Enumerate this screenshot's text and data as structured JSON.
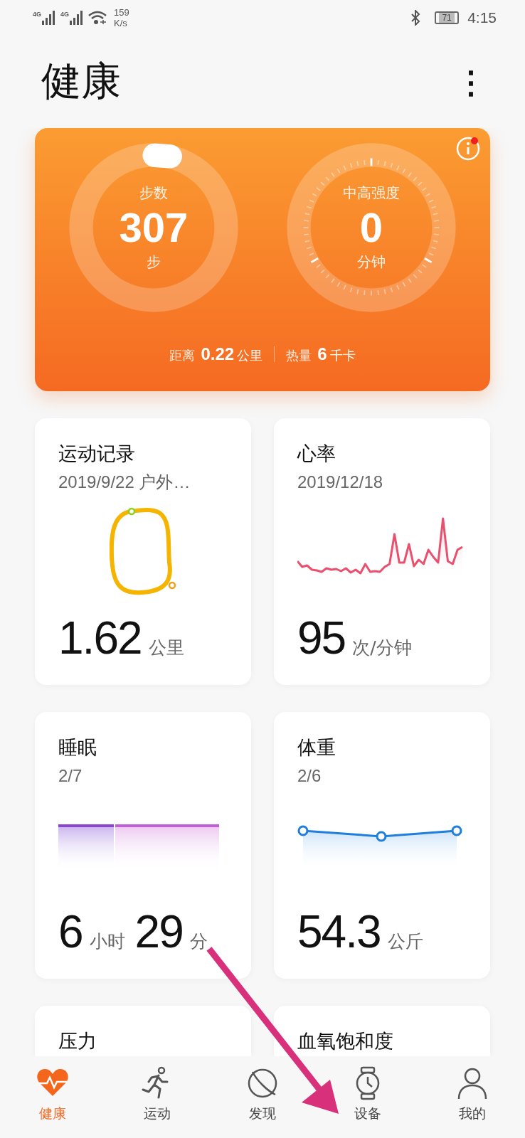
{
  "status_bar": {
    "networks": [
      {
        "label": "4G"
      },
      {
        "label": "4G"
      }
    ],
    "speed": [
      "159",
      "K/s"
    ],
    "battery": "71",
    "time": "4:15"
  },
  "header": {
    "title": "健康",
    "menu": "⋮"
  },
  "summary": {
    "info_badge": true,
    "rings": [
      {
        "kind": "progress",
        "label": "步数",
        "value": "307",
        "unit": "步"
      },
      {
        "kind": "dial",
        "label": "中高强度",
        "value": "0",
        "unit": "分钟"
      }
    ],
    "stats": [
      {
        "label": "距离",
        "value": "0.22",
        "unit": "公里"
      },
      {
        "label": "热量",
        "value": "6",
        "unit": "千卡"
      }
    ]
  },
  "cards": [
    {
      "kind": "route",
      "title": "运动记录",
      "subtitle": "2019/9/22 户外…",
      "values": [
        {
          "number": "1.62",
          "unit": "公里"
        }
      ]
    },
    {
      "kind": "heart",
      "title": "心率",
      "subtitle": "2019/12/18",
      "values": [
        {
          "number": "95",
          "unit": "次/分钟"
        }
      ]
    },
    {
      "kind": "sleep",
      "title": "睡眠",
      "subtitle": "2/7",
      "values": [
        {
          "number": "6",
          "unit": "小时"
        },
        {
          "number": "29",
          "unit": "分"
        }
      ]
    },
    {
      "kind": "weight",
      "title": "体重",
      "subtitle": "2/6",
      "values": [
        {
          "number": "54.3",
          "unit": "公斤"
        }
      ]
    },
    {
      "kind": "partial",
      "title": "压力"
    },
    {
      "kind": "partial",
      "title": "血氧饱和度"
    }
  ],
  "nav": [
    {
      "kind": "heart",
      "label": "健康",
      "selected": true
    },
    {
      "kind": "runner",
      "label": "运动",
      "selected": false
    },
    {
      "kind": "planet",
      "label": "发现",
      "selected": false
    },
    {
      "kind": "watch",
      "label": "设备",
      "selected": false
    },
    {
      "kind": "person",
      "label": "我的",
      "selected": false
    }
  ],
  "annotation": {
    "kind": "arrow"
  }
}
